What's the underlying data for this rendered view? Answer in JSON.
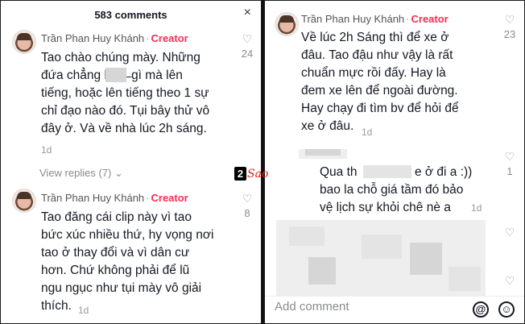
{
  "left": {
    "header": "583 comments",
    "close": "×",
    "comment1": {
      "author": "Trần Phan Huy Khánh",
      "badge": "Creator",
      "text": "Tao chào chúng mày. Những\nđứa chẳng biết  ̶  gì mà lên\ntiếng, hoặc lên tiếng theo 1 sự\nchỉ đạo nào đó. Tụi bây thử vô\nđây ở. Và về nhà lúc 2h sáng.",
      "time": "1d",
      "likes": "24"
    },
    "view_replies": "View replies (7)",
    "comment2": {
      "author": "Trần Phan Huy Khánh",
      "badge": "Creator",
      "text": "Tao đăng cái clip này vì tao\nbức xúc nhiều thứ, hy vọng nơi\ntao ở thay đổi và vì dân cư\nhơn. Chứ không phải để lũ\nngu ngục như tụi mày vô giải\nthích.",
      "time": "1d",
      "likes": "8"
    }
  },
  "right": {
    "comment1": {
      "author": "Trần Phan Huy Khánh",
      "badge": "Creator",
      "text": "Về lúc 2h Sáng thì để xe ở\nđâu. Tao đậu như vậy là rất\nchuẩn mực rồi đấy. Hay là\nđem xe lên để ngoài đường.\nHay chạy đi tìm bv để hỏi để\nxe ở đâu.",
      "time": "1d",
      "likes": "23"
    },
    "reply": {
      "text_a": "Qua th",
      "text_b": "e ở đi a :))",
      "text_c": "bao la chỗ giá tầm đó bảo\nvệ lịch sự khỏi chê nè a",
      "time": "1d",
      "likes": "1"
    },
    "input_placeholder": "Add comment",
    "at_icon": "@",
    "emoji_icon": "☺"
  },
  "watermark": {
    "number": "2",
    "text": "Sao"
  },
  "colors": {
    "creator": "#fe2c55",
    "muted": "#8a8b91",
    "text": "#161823"
  }
}
